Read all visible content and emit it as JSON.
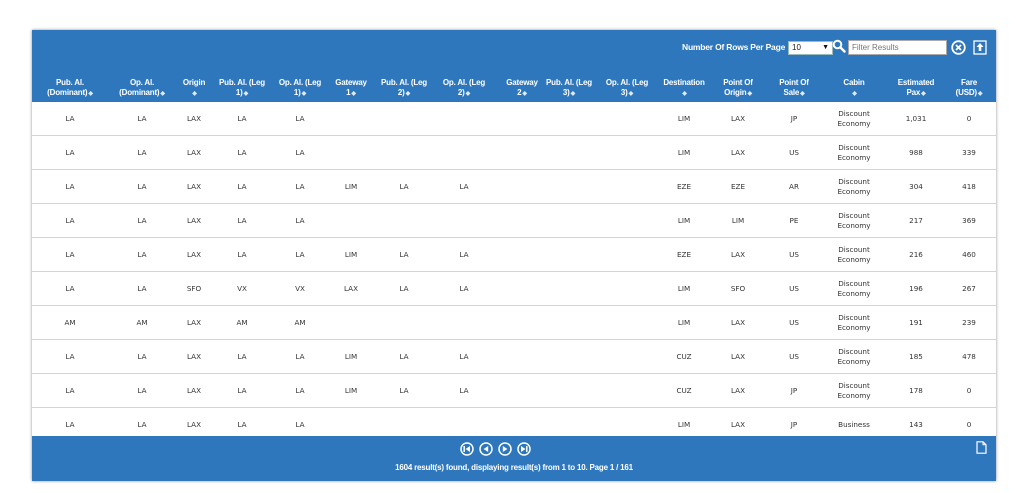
{
  "toolbar": {
    "rows_per_page_label": "Number Of Rows Per Page",
    "rows_per_page_value": "10",
    "filter_placeholder": "Filter Results"
  },
  "columns": [
    {
      "line1": "Pub. Al.",
      "line2": "(Dominant)"
    },
    {
      "line1": "Op. Al.",
      "line2": "(Dominant)"
    },
    {
      "line1": "Origin",
      "line2": ""
    },
    {
      "line1": "Pub. Al. (Leg",
      "line2": "1)"
    },
    {
      "line1": "Op. Al. (Leg",
      "line2": "1)"
    },
    {
      "line1": "Gateway",
      "line2": "1"
    },
    {
      "line1": "Pub. Al. (Leg",
      "line2": "2)"
    },
    {
      "line1": "Op. Al. (Leg",
      "line2": "2)"
    },
    {
      "line1": "Gateway",
      "line2": "2"
    },
    {
      "line1": "Pub. Al. (Leg",
      "line2": "3)"
    },
    {
      "line1": "Op. Al. (Leg",
      "line2": "3)"
    },
    {
      "line1": "Destination",
      "line2": ""
    },
    {
      "line1": "Point Of",
      "line2": "Origin"
    },
    {
      "line1": "Point Of",
      "line2": "Sale"
    },
    {
      "line1": "Cabin",
      "line2": ""
    },
    {
      "line1": "Estimated",
      "line2": "Pax"
    },
    {
      "line1": "Fare",
      "line2": "(USD)"
    }
  ],
  "rows": [
    [
      "LA",
      "LA",
      "LAX",
      "LA",
      "LA",
      "",
      "",
      "",
      "",
      "",
      "",
      "LIM",
      "LAX",
      "JP",
      "Discount Economy",
      "1,031",
      "0"
    ],
    [
      "LA",
      "LA",
      "LAX",
      "LA",
      "LA",
      "",
      "",
      "",
      "",
      "",
      "",
      "LIM",
      "LAX",
      "US",
      "Discount Economy",
      "988",
      "339"
    ],
    [
      "LA",
      "LA",
      "LAX",
      "LA",
      "LA",
      "LIM",
      "LA",
      "LA",
      "",
      "",
      "",
      "EZE",
      "EZE",
      "AR",
      "Discount Economy",
      "304",
      "418"
    ],
    [
      "LA",
      "LA",
      "LAX",
      "LA",
      "LA",
      "",
      "",
      "",
      "",
      "",
      "",
      "LIM",
      "LIM",
      "PE",
      "Discount Economy",
      "217",
      "369"
    ],
    [
      "LA",
      "LA",
      "LAX",
      "LA",
      "LA",
      "LIM",
      "LA",
      "LA",
      "",
      "",
      "",
      "EZE",
      "LAX",
      "US",
      "Discount Economy",
      "216",
      "460"
    ],
    [
      "LA",
      "LA",
      "SFO",
      "VX",
      "VX",
      "LAX",
      "LA",
      "LA",
      "",
      "",
      "",
      "LIM",
      "SFO",
      "US",
      "Discount Economy",
      "196",
      "267"
    ],
    [
      "AM",
      "AM",
      "LAX",
      "AM",
      "AM",
      "",
      "",
      "",
      "",
      "",
      "",
      "LIM",
      "LAX",
      "US",
      "Discount Economy",
      "191",
      "239"
    ],
    [
      "LA",
      "LA",
      "LAX",
      "LA",
      "LA",
      "LIM",
      "LA",
      "LA",
      "",
      "",
      "",
      "CUZ",
      "LAX",
      "US",
      "Discount Economy",
      "185",
      "478"
    ],
    [
      "LA",
      "LA",
      "LAX",
      "LA",
      "LA",
      "LIM",
      "LA",
      "LA",
      "",
      "",
      "",
      "CUZ",
      "LAX",
      "JP",
      "Discount Economy",
      "178",
      "0"
    ],
    [
      "LA",
      "LA",
      "LAX",
      "LA",
      "LA",
      "",
      "",
      "",
      "",
      "",
      "",
      "LIM",
      "LAX",
      "JP",
      "Business",
      "143",
      "0"
    ]
  ],
  "footer": {
    "results_text": "1604 result(s) found, displaying result(s) from 1 to 10. Page 1 / 161"
  },
  "colors": {
    "header_bg": "#2e77bd",
    "row_divider": "#d4d4d4"
  },
  "icons": [
    "search-icon",
    "clear-filter-icon",
    "export-icon",
    "first-page-icon",
    "prev-page-icon",
    "next-page-icon",
    "last-page-icon",
    "document-icon",
    "sort-icon"
  ]
}
